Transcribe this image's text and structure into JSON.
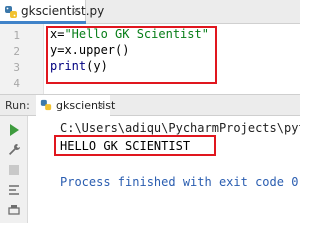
{
  "tab": {
    "filename": "gkscientist.py",
    "close": "×",
    "icon": "python-file-icon"
  },
  "editor": {
    "lines": [
      {
        "number": "1",
        "parts": {
          "a": "x=",
          "b": "\"Hello GK Scientist\""
        }
      },
      {
        "number": "2",
        "parts": {
          "a": "y=x.upper()"
        }
      },
      {
        "number": "3",
        "parts": {
          "a": "print",
          "b": "(y)"
        }
      },
      {
        "number": "4"
      }
    ]
  },
  "run": {
    "label": "Run:",
    "config_name": "gkscientist",
    "close": "×"
  },
  "console": {
    "path": "C:\\Users\\adiqu\\PycharmProjects\\pyth",
    "output": "HELLO GK SCIENTIST",
    "exit": "Process finished with exit code 0"
  },
  "tools": [
    "run-icon",
    "wrench-icon",
    "stop-icon",
    "scroll-icon",
    "print-icon",
    "pin-icon"
  ],
  "colors": {
    "highlight": "#e0161e",
    "string": "#067d17",
    "builtin": "#000080",
    "tab_accent": "#4083c9",
    "exit_text": "#2a5db0"
  }
}
